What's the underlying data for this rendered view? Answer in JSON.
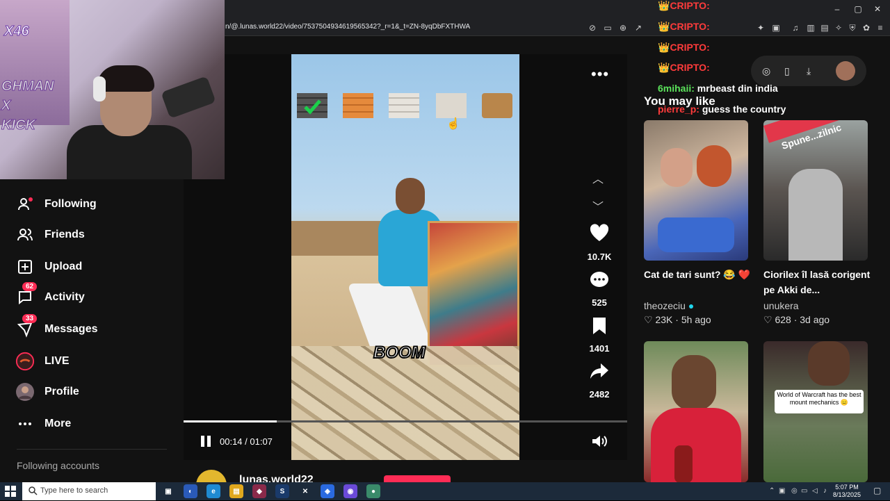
{
  "browser": {
    "url": "n/@.lunas.world22/video/7537504934619565342?_r=1&_t=ZN-8yqDbFXTHWA"
  },
  "sidebar": {
    "items": [
      {
        "label": "Following",
        "icon": "following-icon",
        "badge": ""
      },
      {
        "label": "Friends",
        "icon": "friends-icon",
        "badge": ""
      },
      {
        "label": "Upload",
        "icon": "upload-icon",
        "badge": ""
      },
      {
        "label": "Activity",
        "icon": "activity-icon",
        "badge": "62"
      },
      {
        "label": "Messages",
        "icon": "messages-icon",
        "badge": "33"
      },
      {
        "label": "LIVE",
        "icon": "live-icon",
        "badge": ""
      },
      {
        "label": "Profile",
        "icon": "avatar",
        "badge": ""
      },
      {
        "label": "More",
        "icon": "more-icon",
        "badge": ""
      }
    ],
    "following_accounts": "Following accounts"
  },
  "video": {
    "caption": "BOOM",
    "time": "00:14 / 01:07",
    "progress": 0.21,
    "likes": "10.7K",
    "comments": "525",
    "saves": "1401",
    "shares": "2482",
    "author": "lunas.world22"
  },
  "recommend": {
    "heading": "You may like",
    "cards": [
      {
        "title": "Cat de tari sunt? 😂 ❤️",
        "author": "theozeciu",
        "verified": true,
        "likes": "23K",
        "age": "5h ago",
        "overlay": ""
      },
      {
        "title": "Ciorilex îl lasă corigent pe Akki de...",
        "author": "unukera",
        "verified": false,
        "likes": "628",
        "age": "3d ago",
        "overlay": "Spune...zilnic"
      },
      {
        "title": "",
        "author": "",
        "verified": false,
        "likes": "",
        "age": "",
        "overlay": ""
      },
      {
        "title": "",
        "author": "",
        "verified": false,
        "likes": "",
        "age": "",
        "overlay": "World of Warcraft has the best mount mechanics 😑"
      }
    ]
  },
  "chat": [
    {
      "name": "CRIPTO:",
      "message": "",
      "color": "#ff3b3b"
    },
    {
      "name": "CRIPTO:",
      "message": "",
      "color": "#ff3b3b"
    },
    {
      "name": "CRIPTO:",
      "message": "",
      "color": "#ff3b3b"
    },
    {
      "name": "CRIPTO:",
      "message": "",
      "color": "#ff3b3b"
    },
    {
      "name": "6mihaii:",
      "message": "mrbeast din india",
      "color": "#5be35b"
    },
    {
      "name": "pierre_p:",
      "message": "guess the country",
      "color": "#ff3b3b"
    }
  ],
  "webcam": {
    "badge": "X46",
    "overlay_text": "GHMAN\nX\nKICK"
  },
  "taskbar": {
    "search_placeholder": "Type here to search",
    "time": "5:07 PM",
    "date": "8/13/2025"
  },
  "colors": {
    "accent": "#fe2c55",
    "background": "#121212"
  }
}
